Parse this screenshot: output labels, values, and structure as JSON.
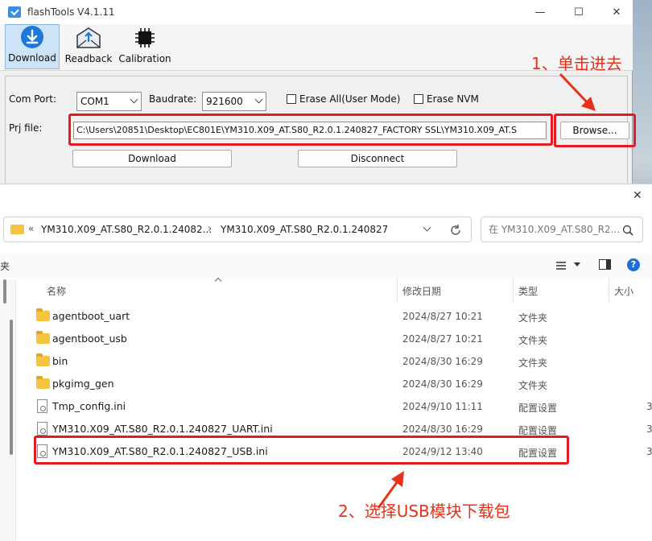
{
  "flashtools": {
    "title": "flashTools V4.1.11",
    "controls": {
      "minimize": "—",
      "maximize": "☐",
      "close": "✕"
    },
    "toolbar": [
      {
        "label": "Download",
        "icon": "download-icon",
        "active": true
      },
      {
        "label": "Readback",
        "icon": "readback-envelope-icon",
        "active": false
      },
      {
        "label": "Calibration",
        "icon": "chip-icon",
        "active": false
      }
    ],
    "form": {
      "com_port_label": "Com Port:",
      "com_port_value": "COM1",
      "baudrate_label": "Baudrate:",
      "baudrate_value": "921600",
      "erase_all_label": "Erase All(User Mode)",
      "erase_nvm_label": "Erase NVM",
      "prj_file_label": "Prj file:",
      "prj_file_value": "C:\\Users\\20851\\Desktop\\EC801E\\YM310.X09_AT.S80_R2.0.1.240827_FACTORY   SSL\\YM310.X09_AT.S",
      "browse_label": "Browse...",
      "download_label": "Download",
      "disconnect_label": "Disconnect"
    }
  },
  "annotations": {
    "step1": "1、单击进去",
    "step2": "2、选择USB模块下载包",
    "accent": "#e31b23"
  },
  "dialog": {
    "close": "✕",
    "breadcrumb": {
      "overflow": "«",
      "parent": "YM310.X09_AT.S80_R2.0.1.24082...",
      "separator": "›",
      "current": "YM310.X09_AT.S80_R2.0.1.240827"
    },
    "search_placeholder": "在 YM310.X09_AT.S80_R2...",
    "left_pane_label": "夹",
    "columns": {
      "name": "名称",
      "date": "修改日期",
      "type": "类型",
      "size": "大小"
    },
    "files": [
      {
        "name": "agentboot_uart",
        "date": "2024/8/27 10:21",
        "type": "文件夹",
        "size": "",
        "kind": "folder"
      },
      {
        "name": "agentboot_usb",
        "date": "2024/8/27 10:21",
        "type": "文件夹",
        "size": "",
        "kind": "folder"
      },
      {
        "name": "bin",
        "date": "2024/8/30 16:29",
        "type": "文件夹",
        "size": "",
        "kind": "folder"
      },
      {
        "name": "pkgimg_gen",
        "date": "2024/8/30 16:29",
        "type": "文件夹",
        "size": "",
        "kind": "folder"
      },
      {
        "name": "Tmp_config.ini",
        "date": "2024/9/10 11:11",
        "type": "配置设置",
        "size": "3",
        "kind": "ini"
      },
      {
        "name": "YM310.X09_AT.S80_R2.0.1.240827_UART.ini",
        "date": "2024/8/30 16:29",
        "type": "配置设置",
        "size": "3",
        "kind": "ini"
      },
      {
        "name": "YM310.X09_AT.S80_R2.0.1.240827_USB.ini",
        "date": "2024/9/12 13:40",
        "type": "配置设置",
        "size": "3",
        "kind": "ini"
      }
    ]
  }
}
